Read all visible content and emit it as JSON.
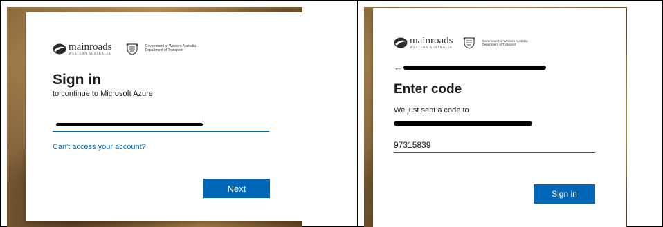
{
  "left": {
    "logo_mainroads": "mainroads",
    "logo_mainroads_sub": "WESTERN AUSTRALIA",
    "logo_gov_line1": "Government of Western Australia",
    "logo_gov_line2": "Department of Transport",
    "title": "Sign in",
    "subtitle": "to continue to Microsoft Azure",
    "email_value": "",
    "link_text": "Can't access your account?",
    "next_label": "Next"
  },
  "right": {
    "logo_mainroads": "mainroads",
    "logo_mainroads_sub": "WESTERN AUSTRALIA",
    "logo_gov_line1": "Government of Western Australia",
    "logo_gov_line2": "Department of Transport",
    "back_arrow": "←",
    "title": "Enter code",
    "message": "We just sent a code to",
    "code_value": "97315839",
    "signin_label": "Sign in"
  },
  "icons": {
    "mainroads_logo": "mainroads-wing-icon",
    "gov_crest": "wa-crest-icon",
    "back": "back-arrow-icon"
  },
  "colors": {
    "accent": "#0067b8",
    "text": "#1b1b1b"
  }
}
